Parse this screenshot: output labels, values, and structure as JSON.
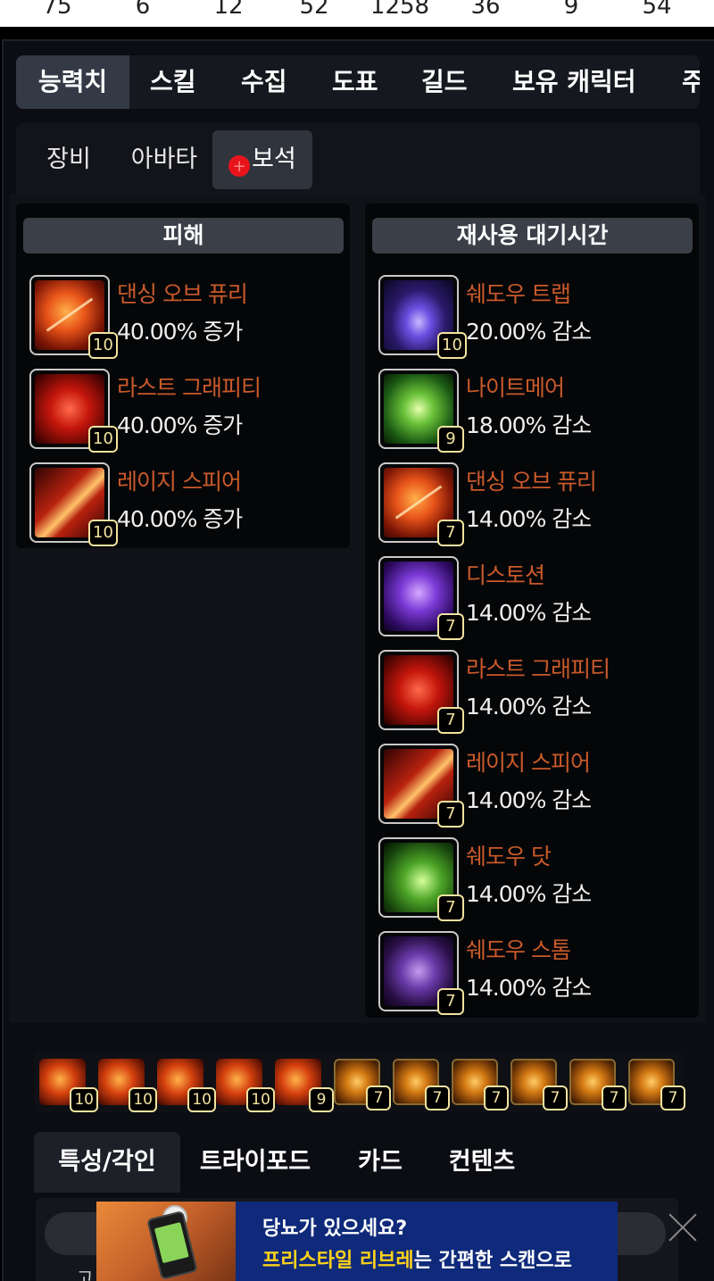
{
  "top_numbers": [
    "75",
    "6",
    "12",
    "52",
    "1258",
    "36",
    "9",
    "54"
  ],
  "main_tabs": [
    "능력치",
    "스킬",
    "수집",
    "도표",
    "길드",
    "보유 캐릭터",
    "주"
  ],
  "sub_tabs": [
    "장비",
    "아바타",
    "보석"
  ],
  "damage": {
    "header": "피해",
    "items": [
      {
        "name": "댄싱 오브 퓨리",
        "effect": "40.00% 증가",
        "level": "10",
        "icon": "dancing-of-fury-icon"
      },
      {
        "name": "라스트 그래피티",
        "effect": "40.00% 증가",
        "level": "10",
        "icon": "last-graffiti-icon"
      },
      {
        "name": "레이지 스피어",
        "effect": "40.00% 증가",
        "level": "10",
        "icon": "rage-spear-icon"
      }
    ]
  },
  "cooldown": {
    "header": "재사용 대기시간",
    "items": [
      {
        "name": "쉐도우 트랩",
        "effect": "20.00% 감소",
        "level": "10",
        "icon": "shadow-trap-icon"
      },
      {
        "name": "나이트메어",
        "effect": "18.00% 감소",
        "level": "9",
        "icon": "nightmare-icon"
      },
      {
        "name": "댄싱 오브 퓨리",
        "effect": "14.00% 감소",
        "level": "7",
        "icon": "dancing-of-fury-icon"
      },
      {
        "name": "디스토션",
        "effect": "14.00% 감소",
        "level": "7",
        "icon": "distortion-icon"
      },
      {
        "name": "라스트 그래피티",
        "effect": "14.00% 감소",
        "level": "7",
        "icon": "last-graffiti-icon"
      },
      {
        "name": "레이지 스피어",
        "effect": "14.00% 감소",
        "level": "7",
        "icon": "rage-spear-icon"
      },
      {
        "name": "쉐도우 닷",
        "effect": "14.00% 감소",
        "level": "7",
        "icon": "shadow-dot-icon"
      },
      {
        "name": "쉐도우 스톰",
        "effect": "14.00% 감소",
        "level": "7",
        "icon": "shadow-storm-icon"
      }
    ]
  },
  "gem_strip": [
    "10",
    "10",
    "10",
    "10",
    "9",
    "7",
    "7",
    "7",
    "7",
    "7",
    "7"
  ],
  "bottom_tabs": [
    "특성/각인",
    "트라이포드",
    "카드",
    "컨텐츠"
  ],
  "ad": {
    "line1": "당뇨가 있으세요?",
    "line2_highlight": "프리스타일 리브레",
    "line2_rest": "는 간편한 스캔으로"
  },
  "colors": {
    "gem_name": "#c95a2b",
    "level_badge": "#f2e3a0",
    "notification_dot": "#e8141c"
  }
}
